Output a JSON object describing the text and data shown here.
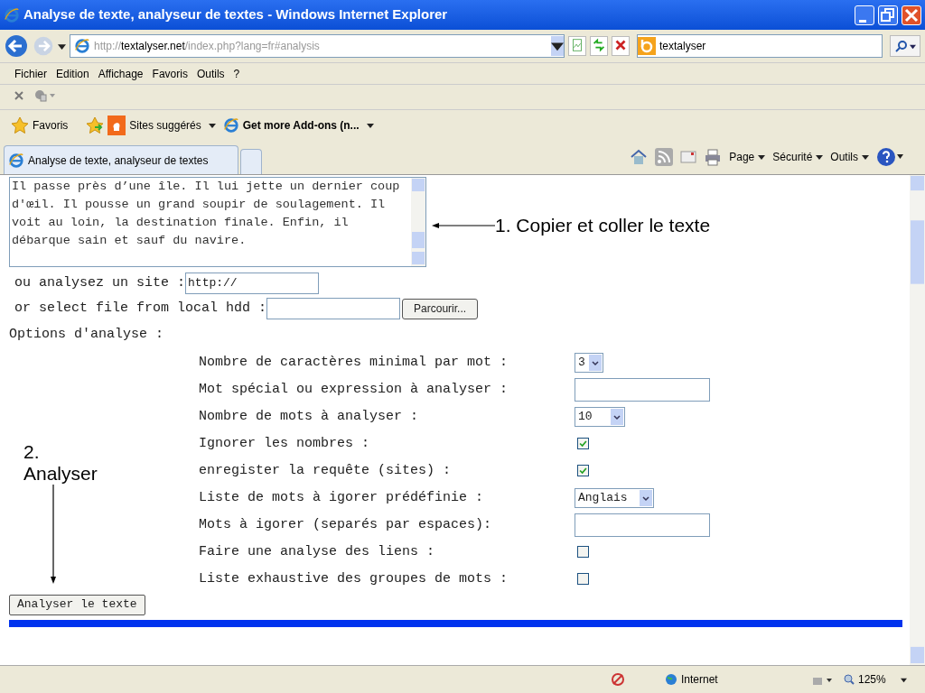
{
  "window": {
    "title": "Analyse de texte, analyseur de textes - Windows Internet Explorer"
  },
  "address_bar": {
    "prefix": "http://",
    "domain": "textalyser.net",
    "path": "/index.php?lang=fr#analysis"
  },
  "search_box": {
    "value": "textalyser"
  },
  "menu": [
    "Fichier",
    "Edition",
    "Affichage",
    "Favoris",
    "Outils",
    "?"
  ],
  "favorites_bar": [
    {
      "label": "Favoris",
      "kind": "favorites"
    },
    {
      "label": "Sites suggérés",
      "kind": "suggested"
    },
    {
      "label": "Get more Add-ons (n...",
      "kind": "addons"
    }
  ],
  "tab": {
    "label": "Analyse de texte, analyseur de textes"
  },
  "command_bar": [
    "Page",
    "Sécurité",
    "Outils"
  ],
  "page": {
    "text_area": "Il passe près d’une île. Il lui jette un dernier coup\nd'œil. Il pousse un grand soupir de soulagement. Il\nvoit au loin, la destination finale. Enfin, il\ndébarque sain et sauf du navire.",
    "site_label": "ou analysez un site :",
    "site_value": "http://",
    "file_label": "or select file from local hdd :",
    "browse_button": "Parcourir...",
    "options_heading": "Options d'analyse :",
    "options": [
      {
        "label": "Nombre de caractères minimal par mot :",
        "kind": "select",
        "value": "3"
      },
      {
        "label": "Mot spécial ou expression à analyser :",
        "kind": "text"
      },
      {
        "label": "Nombre de mots à analyser :",
        "kind": "select",
        "value": "10"
      },
      {
        "label": "Ignorer les nombres :",
        "kind": "checkbox",
        "checked": true
      },
      {
        "label": "enregister la requête (sites) :",
        "kind": "checkbox",
        "checked": true
      },
      {
        "label": "Liste de mots à igorer prédéfinie :",
        "kind": "select",
        "value": "Anglais"
      },
      {
        "label": "Mots à igorer (separés par espaces):",
        "kind": "text"
      },
      {
        "label": "Faire une analyse des liens :",
        "kind": "checkbox",
        "checked": false
      },
      {
        "label": "Liste exhaustive des groupes de mots :",
        "kind": "checkbox",
        "checked": false
      }
    ],
    "submit_button": "Analyser le texte"
  },
  "annotations": {
    "step_1": "1. Copier et coller le texte",
    "step_2": "2.\nAnalyser"
  },
  "status_bar": {
    "zone": "Internet",
    "zoom": "125%"
  }
}
